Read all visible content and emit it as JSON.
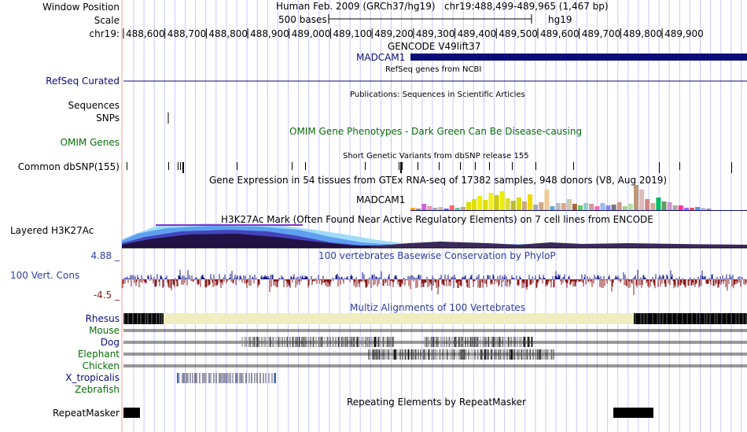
{
  "labels": {
    "window_position": "Window Position",
    "scale": "Scale",
    "chr": "chr19:",
    "refseq": "RefSeq Curated",
    "sequences": "Sequences",
    "snps": "SNPs",
    "omim": "OMIM Genes",
    "dbsnp": "Common dbSNP(155)",
    "layered": "Layered H3K27Ac",
    "cons_top": "4.88 _",
    "cons_name": "100 Vert. Cons",
    "cons_bot": "-4.5 _",
    "rhesus": "Rhesus",
    "mouse": "Mouse",
    "dog": "Dog",
    "elephant": "Elephant",
    "chicken": "Chicken",
    "xtrop": "X_tropicalis",
    "zebrafish": "Zebrafish",
    "repeatmasker": "RepeatMasker"
  },
  "header": {
    "assembly": "Human Feb. 2009 (GRCh37/hg19)",
    "position": "chr19:488,499-489,965 (1,467 bp)",
    "scale_text": "500 bases",
    "scale_db": "hg19"
  },
  "ruler_ticks": [
    "488,600",
    "488,700",
    "488,800",
    "488,900",
    "489,000",
    "489,100",
    "489,200",
    "489,300",
    "489,400",
    "489,500",
    "489,600",
    "489,700",
    "489,800",
    "489,900"
  ],
  "tracks": {
    "gencode_title": "GENCODE V49lift37",
    "gene_name": "MADCAM1",
    "refseq_title": "RefSeq genes from NCBI",
    "publications_title": "Publications: Sequences in Scientific Articles",
    "omim_title": "OMIM Gene Phenotypes - Dark Green Can Be Disease-causing",
    "dbsnp_title": "Short Genetic Variants from dbSNP release 155",
    "gtex_title": "Gene Expression in 54 tissues from GTEx RNA-seq of 17382 samples, 948 donors (V8, Aug 2019)",
    "gtex_gene": "MADCAM1",
    "h3k27ac_title": "H3K27Ac Mark (Often Found Near Active Regulatory Elements) on 7 cell lines from ENCODE",
    "phylop_title": "100 vertebrates Basewise Conservation by PhyloP",
    "multiz_title": "Multiz Alignments of 100 Vertebrates",
    "repeat_title": "Repeating Elements by RepeatMasker"
  },
  "colors": {
    "gene": "#0c0c78",
    "grid": "#c8c8ff",
    "guide_line": "#ff9999",
    "phylop_pos": "#1a1a8a",
    "phylop_neg": "#8a1a1a",
    "rhesus_gap": "#f0eec0"
  }
}
